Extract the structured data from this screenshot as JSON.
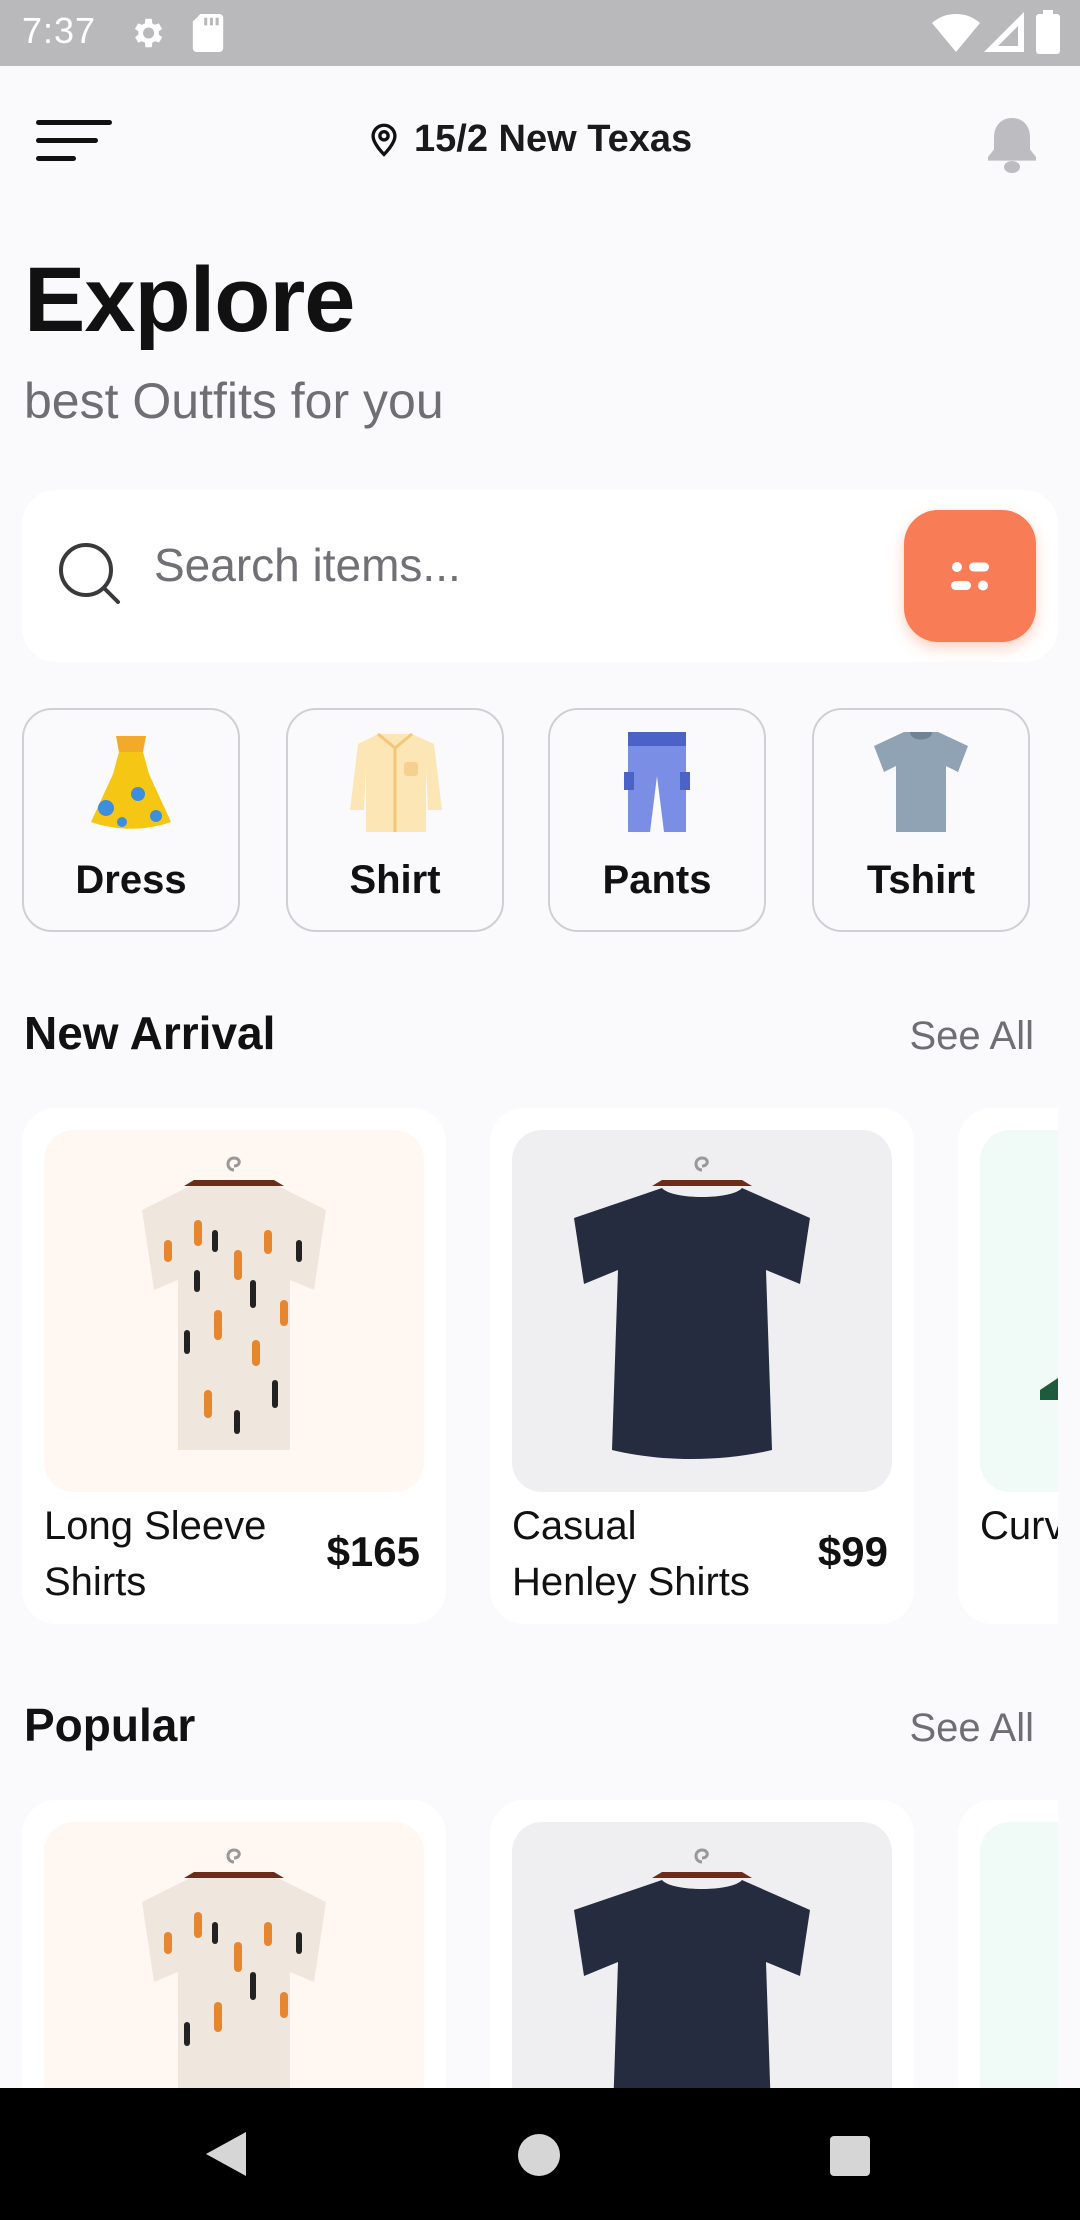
{
  "status_bar": {
    "time": "7:37",
    "icons": [
      "gear-icon",
      "sd-card-icon",
      "wifi-icon",
      "signal-icon",
      "battery-icon"
    ]
  },
  "header": {
    "menu_icon": "hamburger-menu-icon",
    "location_icon": "location-pin-icon",
    "location": "15/2 New Texas",
    "notification_icon": "bell-icon"
  },
  "title": "Explore",
  "subtitle": "best Outfits for you",
  "search": {
    "placeholder": "Search items...",
    "filter_icon": "filter-icon"
  },
  "categories": [
    {
      "label": "Dress",
      "icon": "dress-icon"
    },
    {
      "label": "Shirt",
      "icon": "shirt-icon"
    },
    {
      "label": "Pants",
      "icon": "pants-icon"
    },
    {
      "label": "Tshirt",
      "icon": "tshirt-icon"
    }
  ],
  "new_arrival": {
    "title": "New Arrival",
    "see_all": "See All",
    "items": [
      {
        "name": "Long Sleeve Shirts",
        "price": "$165"
      },
      {
        "name": "Casual Henley Shirts",
        "price": "$99"
      },
      {
        "name": "Curv Shirt",
        "price": ""
      }
    ]
  },
  "popular": {
    "title": "Popular",
    "see_all": "See All"
  },
  "colors": {
    "accent": "#f87d57",
    "background": "#fafafc",
    "status_bar": "#b9b9bb"
  },
  "nav_bar": {
    "back_icon": "back-triangle-icon",
    "home_icon": "home-circle-icon",
    "recents_icon": "recents-square-icon"
  }
}
